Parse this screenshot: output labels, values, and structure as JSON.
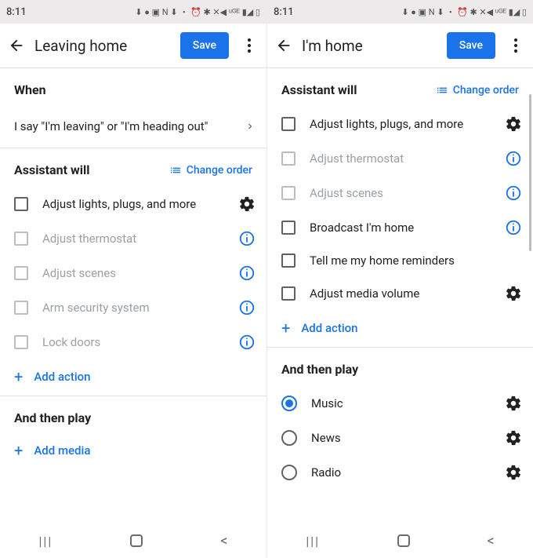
{
  "left": {
    "statusbar": {
      "time": "8:11",
      "icons": "⬇ ● ▣ N ⬇ ・  ⏰ ✱ ✕◀ ᵘᴳᴱ ▮◢ ▯"
    },
    "appbar": {
      "title": "Leaving home",
      "save": "Save"
    },
    "when": {
      "heading": "When",
      "trigger": "I say \"I'm leaving\" or \"I'm heading out\""
    },
    "assistant": {
      "heading": "Assistant will",
      "change_order": "Change order",
      "items": [
        {
          "label": "Adjust lights, plugs, and more",
          "enabled": true,
          "trailing": "gear"
        },
        {
          "label": "Adjust thermostat",
          "enabled": false,
          "trailing": "info"
        },
        {
          "label": "Adjust scenes",
          "enabled": false,
          "trailing": "info"
        },
        {
          "label": "Arm security system",
          "enabled": false,
          "trailing": "info"
        },
        {
          "label": "Lock doors",
          "enabled": false,
          "trailing": "info"
        }
      ],
      "add": "Add action"
    },
    "play": {
      "heading": "And then play",
      "add": "Add media"
    }
  },
  "right": {
    "statusbar": {
      "time": "8:11",
      "icons": "⬇ ● ▣ N ⬇ ・  ⏰ ✱ ✕◀ ᵘᴳᴱ ▮◢ ▯"
    },
    "appbar": {
      "title": "I'm home",
      "save": "Save"
    },
    "assistant": {
      "heading": "Assistant will",
      "change_order": "Change order",
      "items": [
        {
          "label": "Adjust lights, plugs, and more",
          "enabled": true,
          "trailing": "gear"
        },
        {
          "label": "Adjust thermostat",
          "enabled": false,
          "trailing": "info"
        },
        {
          "label": "Adjust scenes",
          "enabled": false,
          "trailing": "info"
        },
        {
          "label": "Broadcast I'm home",
          "enabled": true,
          "trailing": "info"
        },
        {
          "label": "Tell me my home reminders",
          "enabled": true,
          "trailing": "none"
        },
        {
          "label": "Adjust media volume",
          "enabled": true,
          "trailing": "gear"
        }
      ],
      "add": "Add action"
    },
    "play": {
      "heading": "And then play",
      "options": [
        {
          "label": "Music",
          "selected": true,
          "trailing": "gear"
        },
        {
          "label": "News",
          "selected": false,
          "trailing": "gear"
        },
        {
          "label": "Radio",
          "selected": false,
          "trailing": "gear"
        }
      ]
    }
  }
}
